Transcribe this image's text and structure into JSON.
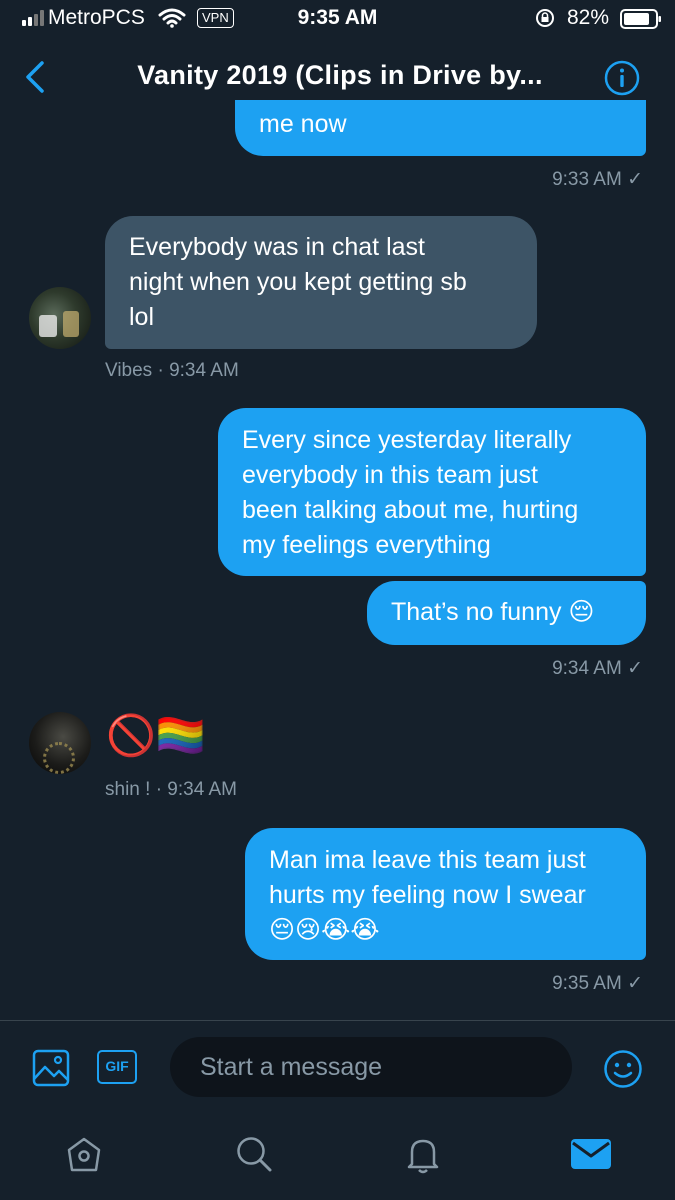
{
  "status_bar": {
    "carrier": "MetroPCS",
    "vpn": "VPN",
    "time": "9:35 AM",
    "battery": "82%"
  },
  "header": {
    "title": "Vanity 2019 (Clips in Drive by..."
  },
  "messages": [
    {
      "direction": "out",
      "text": "me now",
      "time": "9:33 AM ✓"
    },
    {
      "direction": "in",
      "sender": "Vibes",
      "lines": [
        "Everybody was in chat last",
        "night when you kept getting sb",
        "lol"
      ],
      "meta": "Vibes · 9:34 AM"
    },
    {
      "direction": "out",
      "lines": [
        "Every since yesterday literally",
        "everybody in this team just",
        "been talking about me, hurting",
        "my feelings everything"
      ]
    },
    {
      "direction": "out",
      "text": "That’s no funny 😔",
      "time": "9:34 AM ✓"
    },
    {
      "direction": "in",
      "sender": "shin !",
      "text": "🚫🏳️‍🌈",
      "meta": "shin ! · 9:34 AM"
    },
    {
      "direction": "out",
      "lines": [
        "Man ima leave this team just",
        "hurts my feeling now I swear",
        "😔😢😭😭"
      ],
      "time": "9:35 AM ✓"
    }
  ],
  "composer": {
    "gif_label": "GIF",
    "placeholder": "Start a message"
  },
  "colors": {
    "background": "#15202b",
    "accent": "#1da1f2",
    "incoming_bubble": "#3d5466",
    "muted_text": "#8899a6"
  },
  "icons": [
    "back-arrow-icon",
    "info-icon",
    "image-icon",
    "gif-icon",
    "emoji-icon",
    "home-icon",
    "search-icon",
    "notifications-icon",
    "messages-icon"
  ]
}
